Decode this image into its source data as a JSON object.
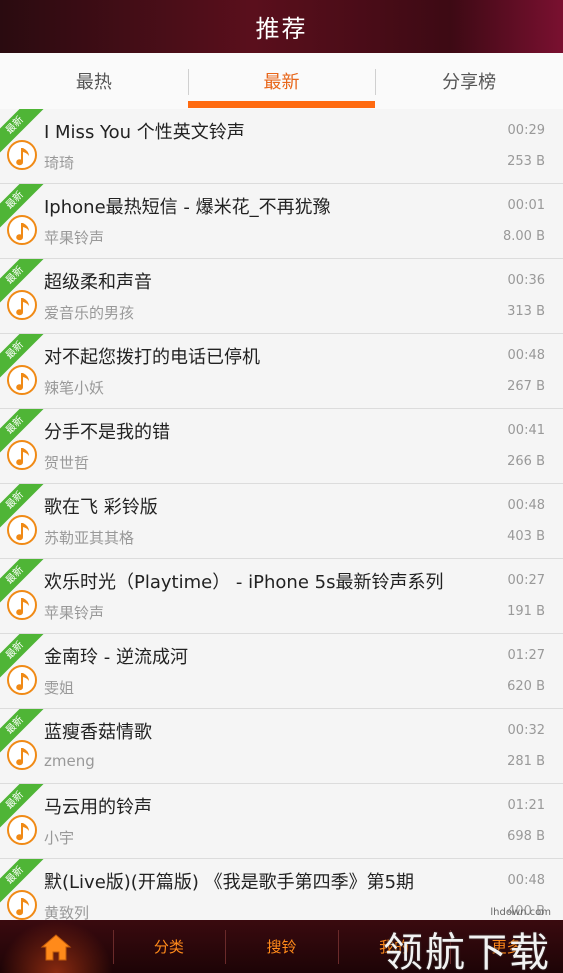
{
  "header": {
    "title": "推荐"
  },
  "tabs": [
    {
      "label": "最热",
      "active": false
    },
    {
      "label": "最新",
      "active": true
    },
    {
      "label": "分享榜",
      "active": false
    }
  ],
  "badge_label": "最新",
  "songs": [
    {
      "title": "I Miss You 个性英文铃声",
      "artist": "琦琦",
      "duration": "00:29",
      "size": "253 B"
    },
    {
      "title": "Iphone最热短信 - 爆米花_不再犹豫",
      "artist": "苹果铃声",
      "duration": "00:01",
      "size": "8.00 B"
    },
    {
      "title": "超级柔和声音",
      "artist": "爱音乐的男孩",
      "duration": "00:36",
      "size": "313 B"
    },
    {
      "title": "对不起您拨打的电话已停机",
      "artist": "辣笔小妖",
      "duration": "00:48",
      "size": "267 B"
    },
    {
      "title": "分手不是我的错",
      "artist": "贺世哲",
      "duration": "00:41",
      "size": "266 B"
    },
    {
      "title": "歌在飞 彩铃版",
      "artist": "苏勒亚其其格",
      "duration": "00:48",
      "size": "403 B"
    },
    {
      "title": "欢乐时光（Playtime） - iPhone 5s最新铃声系列",
      "artist": "苹果铃声",
      "duration": "00:27",
      "size": "191 B"
    },
    {
      "title": "金南玲 - 逆流成河",
      "artist": "雯姐",
      "duration": "01:27",
      "size": "620 B"
    },
    {
      "title": "蓝瘦香菇情歌",
      "artist": "zmeng",
      "duration": "00:32",
      "size": "281 B"
    },
    {
      "title": "马云用的铃声",
      "artist": "小宇",
      "duration": "01:21",
      "size": "698 B"
    },
    {
      "title": "默(Live版)(开篇版) 《我是歌手第四季》第5期",
      "artist": "黄致列",
      "duration": "00:48",
      "size": "400 B"
    }
  ],
  "bottom_nav": [
    {
      "label": "",
      "icon": "home-icon"
    },
    {
      "label": "分类"
    },
    {
      "label": "搜铃"
    },
    {
      "label": "我的"
    },
    {
      "label": "更多"
    }
  ],
  "watermark": {
    "text": "领航下载",
    "url": "lhdown.com"
  },
  "colors": {
    "accent": "#ff6a10",
    "badge": "#4fb536",
    "icon_ring": "#f08a16",
    "header_bg": "#5a0f1c"
  }
}
